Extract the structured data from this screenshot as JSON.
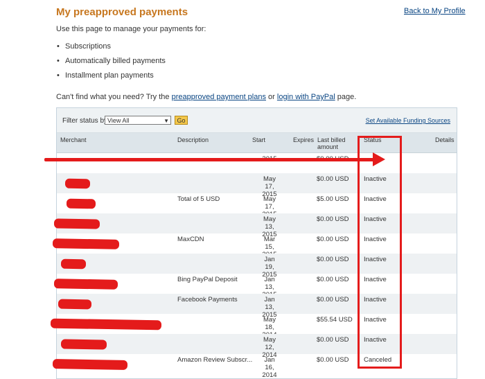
{
  "header": {
    "title": "My preapproved payments",
    "back_link": "Back to My Profile"
  },
  "intro": "Use this page to manage your payments for:",
  "bullets": [
    "Subscriptions",
    "Automatically billed payments",
    "Installment plan payments"
  ],
  "help": {
    "prefix": "Can't find what you need? Try the",
    "link1": "preapproved payment plans",
    "middle": "or",
    "link2": "login with PayPal",
    "suffix": "page."
  },
  "filter": {
    "label": "Filter status by:",
    "selected": "View All",
    "go": "Go",
    "funding_link": "Set Available Funding Sources"
  },
  "columns": {
    "merchant": "Merchant",
    "description": "Description",
    "start": "Start",
    "expires": "Expires",
    "last_billed": "Last billed amount",
    "status": "Status",
    "details": "Details"
  },
  "rows": [
    {
      "desc": "",
      "start": "2015",
      "last": "$0.00 USD",
      "status": ""
    },
    {
      "desc": "",
      "start": "May 17, 2015",
      "last": "$0.00 USD",
      "status": "Inactive"
    },
    {
      "desc": "Total of 5 USD",
      "start": "May 17, 2015",
      "last": "$5.00 USD",
      "status": "Inactive"
    },
    {
      "desc": "",
      "start": "May 13, 2015",
      "last": "$0.00 USD",
      "status": "Inactive"
    },
    {
      "desc": "MaxCDN",
      "start": "Mar 15, 2015",
      "last": "$0.00 USD",
      "status": "Inactive"
    },
    {
      "desc": "",
      "start": "Jan 19, 2015",
      "last": "$0.00 USD",
      "status": "Inactive"
    },
    {
      "desc": "Bing PayPal Deposit",
      "start": "Jan 13, 2015",
      "last": "$0.00 USD",
      "status": "Inactive"
    },
    {
      "desc": "Facebook Payments",
      "start": "Jan 13, 2015",
      "last": "$0.00 USD",
      "status": "Inactive"
    },
    {
      "desc": "",
      "start": "May 18, 2014",
      "last": "$55.54 USD",
      "status": "Inactive"
    },
    {
      "desc": "",
      "start": "May 12, 2014",
      "last": "$0.00 USD",
      "status": "Inactive"
    },
    {
      "desc": "Amazon Review Subscr...",
      "start": "Jan 16, 2014",
      "last": "$0.00 USD",
      "status": "Canceled"
    }
  ],
  "colors": {
    "accent": "#c7771f",
    "link": "#084482",
    "annotation": "#e41b1b"
  }
}
